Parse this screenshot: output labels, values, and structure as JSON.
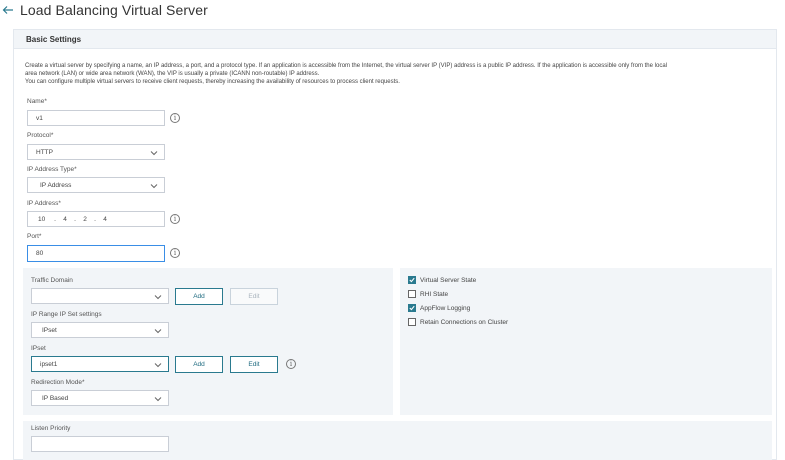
{
  "header": {
    "title": "Load Balancing Virtual Server"
  },
  "panel": {
    "title": "Basic Settings",
    "description": [
      "Create a virtual server by specifying a name, an IP address, a port, and a protocol type. If an application is accessible from the Internet, the virtual server IP (VIP) address is a public IP address. If the application is accessible only from the local",
      "area network (LAN) or wide area network (WAN), the VIP is usually a private (ICANN non-routable) IP address.",
      "You can configure multiple virtual servers to receive client requests, thereby increasing the availability of resources to process client requests."
    ]
  },
  "form": {
    "name": {
      "label": "Name*",
      "value": "v1"
    },
    "protocol": {
      "label": "Protocol*",
      "value": "HTTP"
    },
    "ip_address_type": {
      "label": "IP Address Type*",
      "value": "IP Address"
    },
    "ip_address": {
      "label": "IP Address*",
      "octets": [
        "10",
        "4",
        "2",
        "4"
      ]
    },
    "port": {
      "label": "Port*",
      "value": "80"
    },
    "traffic_domain": {
      "label": "Traffic Domain",
      "value": "",
      "add_label": "Add",
      "edit_label": "Edit"
    },
    "ip_range_ip_set": {
      "label": "IP Range IP Set settings",
      "value": "IPset"
    },
    "ipset": {
      "label": "IPset",
      "value": "ipset1",
      "add_label": "Add",
      "edit_label": "Edit"
    },
    "redirection_mode": {
      "label": "Redirection Mode*",
      "value": "IP Based"
    },
    "listen_priority": {
      "label": "Listen Priority",
      "value": ""
    }
  },
  "options": [
    {
      "label": "Virtual Server State",
      "checked": true
    },
    {
      "label": "RHI State",
      "checked": false
    },
    {
      "label": "AppFlow Logging",
      "checked": true
    },
    {
      "label": "Retain Connections on Cluster",
      "checked": false
    }
  ],
  "colors": {
    "accent": "#2a7a8f",
    "focus": "#3a8ee6",
    "panel_bg": "#f2f5f8"
  }
}
